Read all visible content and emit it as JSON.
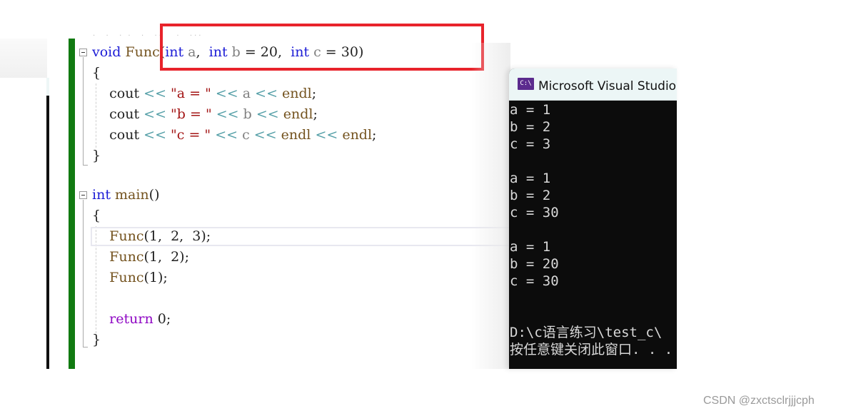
{
  "editor": {
    "lines": [
      {
        "id": "l1",
        "tokens": [
          [
            "kw",
            "void"
          ],
          [
            "fn",
            " Func"
          ],
          [
            "num",
            "("
          ],
          [
            "kw",
            "int"
          ],
          [
            "param",
            " a"
          ],
          [
            "num",
            ", "
          ],
          [
            "kw",
            " int"
          ],
          [
            "param",
            " b"
          ],
          [
            "num",
            " = 20, "
          ],
          [
            "kw",
            " int"
          ],
          [
            "param",
            " c"
          ],
          [
            "num",
            " = 30)"
          ]
        ]
      },
      {
        "id": "l2",
        "tokens": [
          [
            "num",
            "{"
          ]
        ]
      },
      {
        "id": "l3",
        "tokens": [
          [
            "num",
            "    cout "
          ],
          [
            "op",
            "<<"
          ],
          [
            "str",
            " \"a = \" "
          ],
          [
            "op",
            "<<"
          ],
          [
            "param",
            " a "
          ],
          [
            "op",
            "<<"
          ],
          [
            "fn",
            " endl"
          ],
          [
            "num",
            ";"
          ]
        ]
      },
      {
        "id": "l4",
        "tokens": [
          [
            "num",
            "    cout "
          ],
          [
            "op",
            "<<"
          ],
          [
            "str",
            " \"b = \" "
          ],
          [
            "op",
            "<<"
          ],
          [
            "param",
            " b "
          ],
          [
            "op",
            "<<"
          ],
          [
            "fn",
            " endl"
          ],
          [
            "num",
            ";"
          ]
        ]
      },
      {
        "id": "l5",
        "tokens": [
          [
            "num",
            "    cout "
          ],
          [
            "op",
            "<<"
          ],
          [
            "str",
            " \"c = \" "
          ],
          [
            "op",
            "<<"
          ],
          [
            "param",
            " c "
          ],
          [
            "op",
            "<<"
          ],
          [
            "fn",
            " endl "
          ],
          [
            "op",
            "<<"
          ],
          [
            "fn",
            " endl"
          ],
          [
            "num",
            ";"
          ]
        ]
      },
      {
        "id": "l6",
        "tokens": [
          [
            "num",
            "}"
          ]
        ]
      },
      {
        "id": "l7",
        "tokens": []
      },
      {
        "id": "l8",
        "tokens": [
          [
            "kw",
            "int"
          ],
          [
            "fn",
            " main"
          ],
          [
            "num",
            "()"
          ]
        ]
      },
      {
        "id": "l9",
        "tokens": [
          [
            "num",
            "{"
          ]
        ]
      },
      {
        "id": "l10",
        "tokens": [
          [
            "fn",
            "    Func"
          ],
          [
            "num",
            "(1,  2,  3);"
          ]
        ]
      },
      {
        "id": "l11",
        "tokens": [
          [
            "fn",
            "    Func"
          ],
          [
            "num",
            "(1,  2);"
          ]
        ]
      },
      {
        "id": "l12",
        "tokens": [
          [
            "fn",
            "    Func"
          ],
          [
            "num",
            "(1);"
          ]
        ]
      },
      {
        "id": "l13",
        "tokens": []
      },
      {
        "id": "l14",
        "tokens": [
          [
            "ctl",
            "    return"
          ],
          [
            "num",
            " 0;"
          ]
        ]
      },
      {
        "id": "l15",
        "tokens": [
          [
            "num",
            "}"
          ]
        ]
      }
    ]
  },
  "console": {
    "icon_label": "C:\\",
    "title": "Microsoft Visual Studio 调",
    "output_lines": [
      "a = 1",
      "b = 2",
      "c = 3",
      "",
      "a = 1",
      "b = 2",
      "c = 30",
      "",
      "a = 1",
      "b = 20",
      "c = 30",
      "",
      "",
      "D:\\c语言练习\\test_c\\",
      "按任意键关闭此窗口. . ."
    ]
  },
  "colors": {
    "highlight_box": "#e8232b",
    "change_bar": "#117a11",
    "keyword": "#1c1cd6",
    "function": "#74531f",
    "string": "#a31515",
    "control": "#8f08c4"
  },
  "watermark": "CSDN @zxctsclrjjjcph"
}
